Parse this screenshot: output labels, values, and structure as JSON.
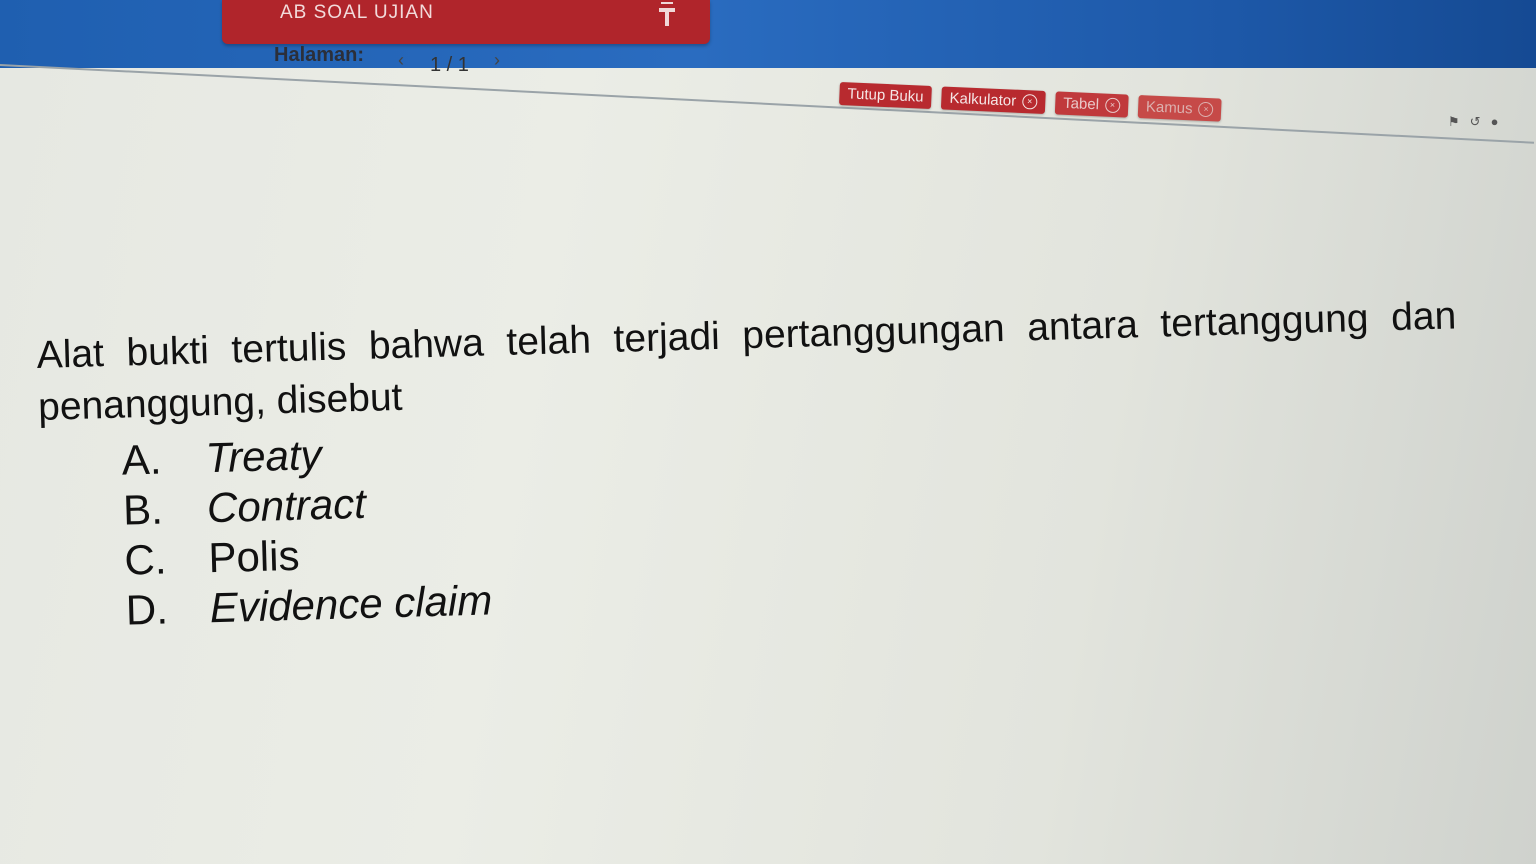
{
  "header": {
    "title_fragment": "AB SOAL UJIAN",
    "icon": "pin-icon"
  },
  "pager": {
    "label": "Halaman:",
    "value": "1 / 1",
    "prev_icon": "chevron-left-icon",
    "next_icon": "chevron-right-icon"
  },
  "toolbar": {
    "close_book": "Tutup Buku",
    "calculator": "Kalkulator",
    "table": "Tabel",
    "dictionary": "Kamus"
  },
  "question": {
    "text": "Alat bukti tertulis bahwa telah terjadi pertanggungan antara tertanggung dan penanggung, disebut",
    "options": [
      {
        "letter": "A.",
        "text": "Treaty"
      },
      {
        "letter": "B.",
        "text": "Contract"
      },
      {
        "letter": "C.",
        "text": "Polis"
      },
      {
        "letter": "D.",
        "text": "Evidence claim"
      }
    ]
  },
  "colors": {
    "topbar_blue": "#1f5fb0",
    "accent_red": "#b0252b",
    "page_bg": "#e6e8e2"
  }
}
